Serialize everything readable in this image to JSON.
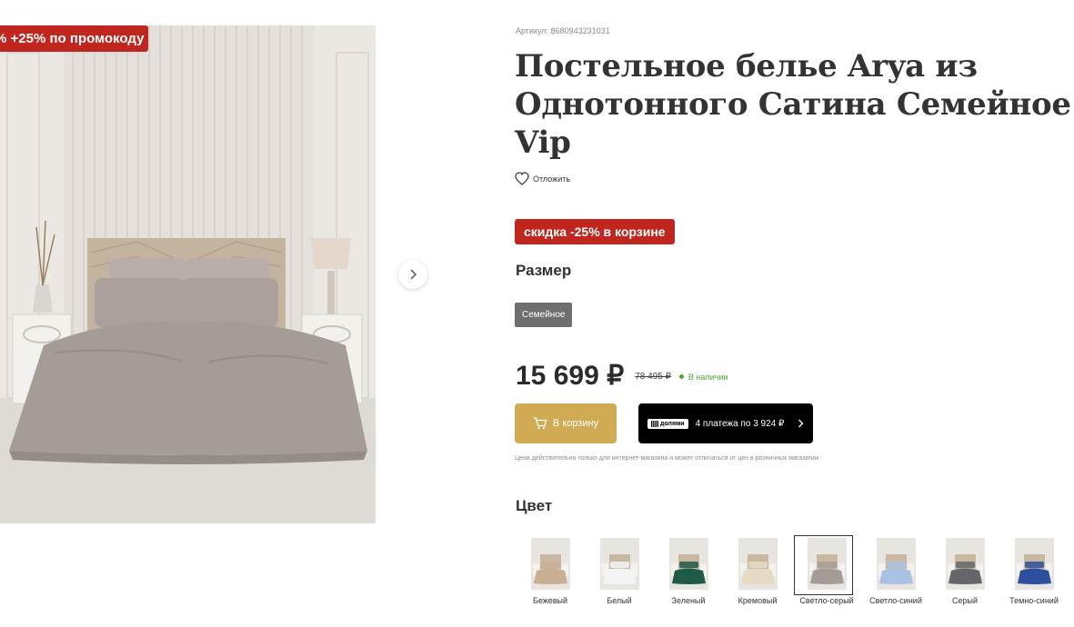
{
  "promo_badge": "% +25% по промокоду",
  "sku": "Артикул: 8680943231031",
  "title": "Постельное белье Arya из Однотонного Сатина Семейное Vip",
  "wishlist_label": "Отложить",
  "discount_badge": "скидка -25% в корзине",
  "size": {
    "heading": "Размер",
    "selected": "Семейное"
  },
  "price": {
    "current": "15 699 ₽",
    "old": "78 495 ₽",
    "stock": "В наличии"
  },
  "cart_button": "В корзину",
  "dolyami": {
    "logo": "долями",
    "label": "4 платежа по 3 924 ₽"
  },
  "price_note": "Цена действительна только для интернет-магазина и может отличаться от цен в розничных магазинах",
  "colors": {
    "heading": "Цвет",
    "items": [
      {
        "name": "Бежевый",
        "swatch": "#c9ae94"
      },
      {
        "name": "Белый",
        "swatch": "#f4f4f6"
      },
      {
        "name": "Зеленый",
        "swatch": "#1f5a48"
      },
      {
        "name": "Кремовый",
        "swatch": "#e6dac4"
      },
      {
        "name": "Светло-серый",
        "swatch": "#a59c98"
      },
      {
        "name": "Светло-синий",
        "swatch": "#a9c2e4"
      },
      {
        "name": "Серый",
        "swatch": "#66656a"
      },
      {
        "name": "Темно-синий",
        "swatch": "#2e4f9e"
      }
    ],
    "selected": "Светло-серый"
  },
  "accent_colors": {
    "promo_red": "#c0261d",
    "cart_gold": "#d1ab54",
    "stock_green": "#4fa433"
  }
}
